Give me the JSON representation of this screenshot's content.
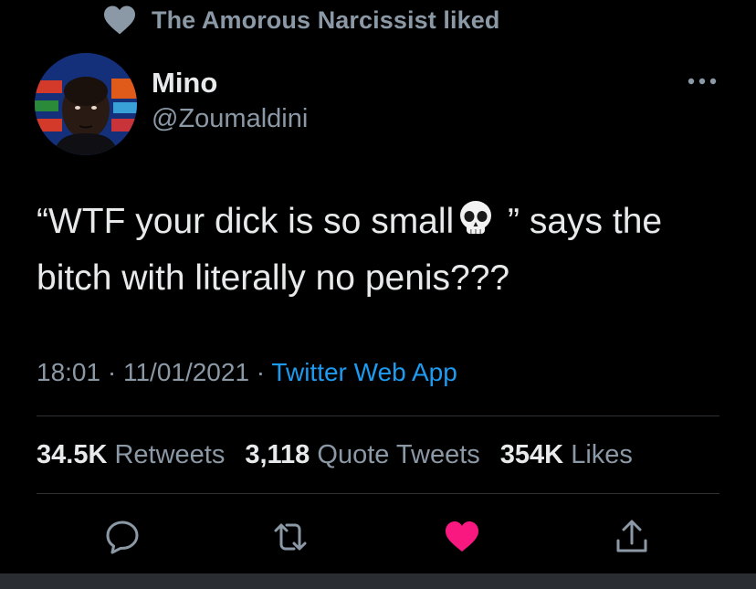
{
  "social_context": {
    "text": "The Amorous Narcissist liked",
    "icon": "heart-icon"
  },
  "author": {
    "name": "Mino",
    "handle": "@Zoumaldini"
  },
  "tweet": {
    "text_part1": "“WTF your dick is so small",
    "emoji": "skull-emoji",
    "text_part2": " ” says the bitch with literally no penis???"
  },
  "meta": {
    "time": "18:01",
    "sep1": " · ",
    "date": "11/01/2021",
    "sep2": " · ",
    "source": "Twitter Web App"
  },
  "stats": [
    {
      "count": "34.5K",
      "label": "Retweets"
    },
    {
      "count": "3,118",
      "label": "Quote Tweets"
    },
    {
      "count": "354K",
      "label": "Likes"
    }
  ],
  "actions": [
    "reply-icon",
    "retweet-icon",
    "like-icon",
    "share-icon"
  ],
  "colors": {
    "background": "#000000",
    "text": "#e7e9ea",
    "muted": "#8b98a5",
    "link": "#1d9bf0",
    "like": "#f91880"
  }
}
